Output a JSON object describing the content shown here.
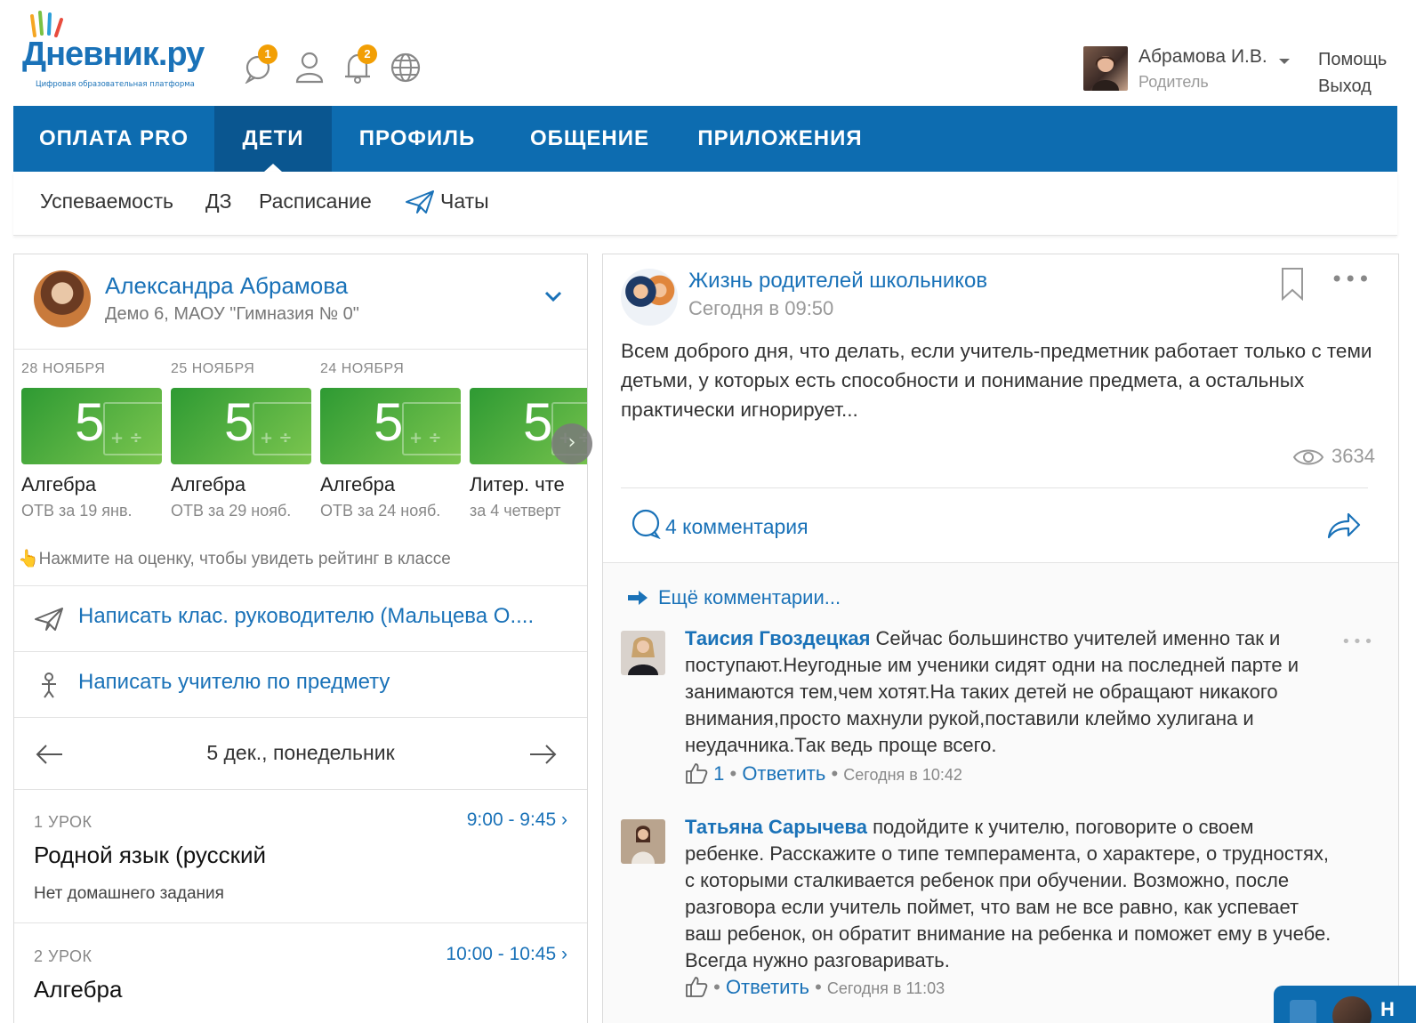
{
  "header": {
    "logo_text": "Дневник.ру",
    "logo_tagline": "Цифровая образовательная платформа",
    "icons": [
      {
        "name": "messages-icon",
        "badge": "1"
      },
      {
        "name": "user-icon",
        "badge": ""
      },
      {
        "name": "bell-icon",
        "badge": "2"
      },
      {
        "name": "globe-icon",
        "badge": ""
      }
    ],
    "user_name": "Абрамова И.В.",
    "user_role": "Родитель",
    "help": "Помощь",
    "logout": "Выход"
  },
  "nav": {
    "items": [
      "ОПЛАТА PRO",
      "ДЕТИ",
      "ПРОФИЛЬ",
      "ОБЩЕНИЕ",
      "ПРИЛОЖЕНИЯ"
    ],
    "active": "ДЕТИ"
  },
  "subnav": {
    "items": [
      "Успеваемость",
      "ДЗ",
      "Расписание",
      "Чаты"
    ]
  },
  "child": {
    "name": "Александра Абрамова",
    "school": "Демо 6, МАОУ \"Гимназия № 0\"",
    "grades": [
      {
        "date": "28 НОЯБРЯ",
        "mark": "5",
        "subject": "Алгебра",
        "desc": "ОТВ за 19 янв."
      },
      {
        "date": "25 НОЯБРЯ",
        "mark": "5",
        "subject": "Алгебра",
        "desc": "ОТВ за 29 нояб."
      },
      {
        "date": "24 НОЯБРЯ",
        "mark": "5",
        "subject": "Алгебра",
        "desc": "ОТВ за 24 нояб."
      },
      {
        "date": "",
        "mark": "5",
        "subject": "Литер. чте",
        "desc": "за 4 четверт"
      }
    ],
    "hint": "Нажмите на оценку, чтобы увидеть рейтинг в классе",
    "write_teacher": "Написать клас. руководителю (Мальцева О....",
    "write_subject": "Написать учителю по предмету",
    "day": "5 дек., понедельник",
    "lessons": [
      {
        "number": "1 УРОК",
        "time": "9:00 - 9:45",
        "subject": "Родной язык (русский",
        "homework": "Нет домашнего задания"
      },
      {
        "number": "2 УРОК",
        "time": "10:00 - 10:45",
        "subject": "Алгебра",
        "homework": ""
      }
    ]
  },
  "post": {
    "group": "Жизнь родителей школьников",
    "date": "Сегодня в 09:50",
    "text": "Всем доброго дня, что делать, если учитель-предметник работает только с теми детьми, у которых есть способности и понимание предмета, а остальных практически игнорирует...",
    "views": "3634",
    "comments_count": "4 комментария",
    "more_comments": "Ещё комментарии...",
    "comments": [
      {
        "author": "Таисия Гвоздецкая",
        "text": "Сейчас большинство учителей именно так и поступают.Неугодные им ученики сидят одни на последней парте и занимаются тем,чем хотят.На таких детей не обращают никакого внимания,просто махнули рукой,поставили клеймо хулигана и неудачника.Так ведь проще всего.",
        "likes": "1",
        "reply": "Ответить",
        "time": "Сегодня в 10:42"
      },
      {
        "author": "Татьяна Сарычева",
        "text": "подойдите к учителю, поговорите о своем ребенке. Расскажите о типе темперамента, о характере, о трудностях, с которыми сталкивается ребенок при обучении. Возможно, после разговора если учитель поймет, что вам не все равно, как успевает ваш ребенок, он обратит внимание на ребенка и поможет ему в учебе. Всегда нужно разговаривать.",
        "likes": "",
        "reply": "Ответить",
        "time": "Сегодня в 11:03"
      }
    ]
  },
  "chat_widget": {
    "label": "Н"
  },
  "colors": {
    "brand": "#0d6cb0",
    "accent": "#1a72b8",
    "grade_green": "#4fb43e",
    "badge": "#f29f05"
  }
}
